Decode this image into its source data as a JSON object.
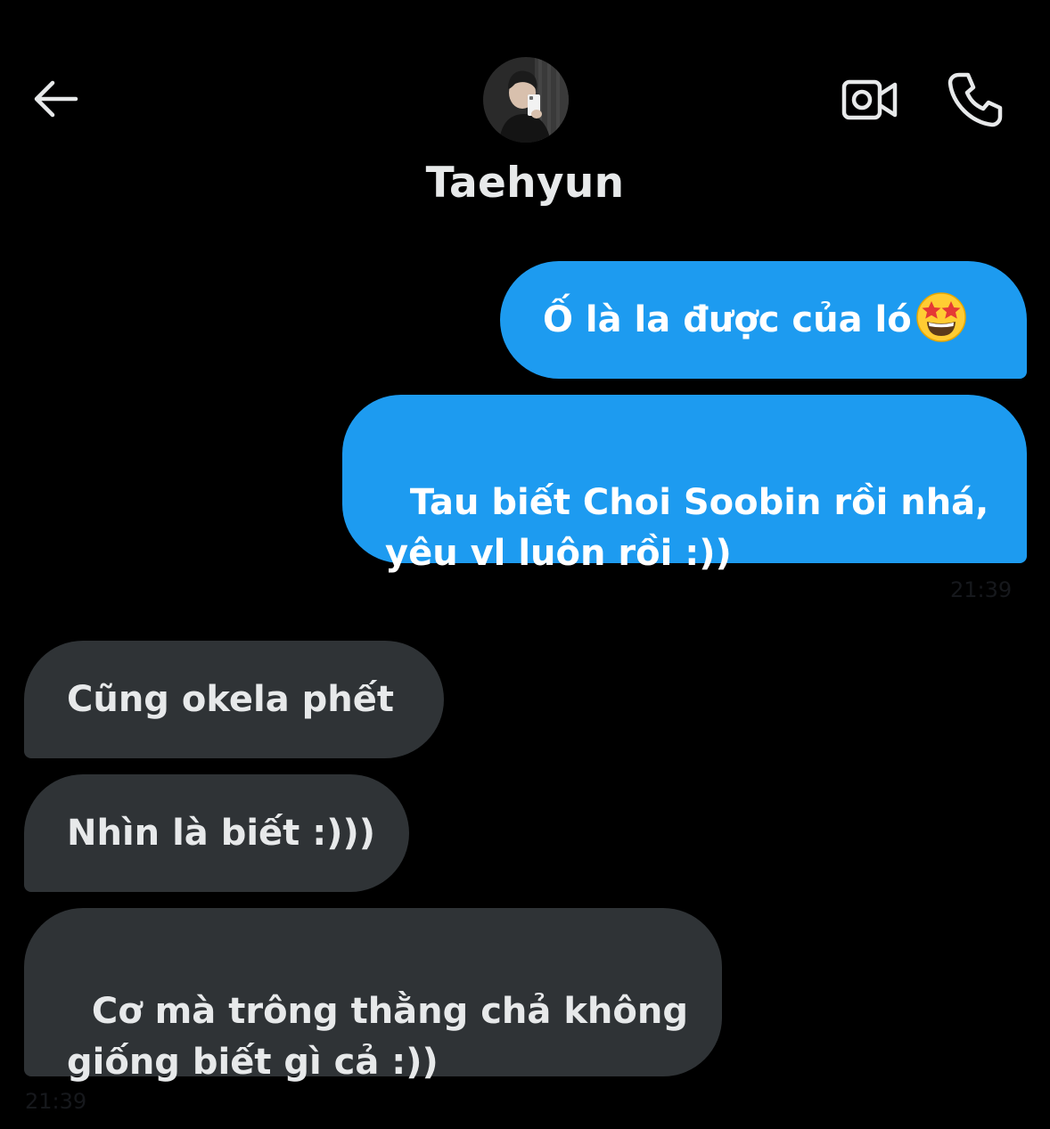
{
  "header": {
    "back_icon": "arrow-left-icon",
    "contact_name": "Taehyun",
    "video_icon": "video-camera-icon",
    "call_icon": "phone-icon"
  },
  "messages": [
    {
      "direction": "outgoing",
      "text": "Ố là la được của ló",
      "emoji": "star-struck-emoji"
    },
    {
      "direction": "outgoing",
      "text": "Tau biết Choi Soobin rồi nhá,\nyêu vl luôn rồi :))"
    },
    {
      "direction": "incoming",
      "text": "Cũng okela phết"
    },
    {
      "direction": "incoming",
      "text": "Nhìn là biết :)))"
    },
    {
      "direction": "incoming",
      "text": "Cơ mà trông thằng chả không\ngiống biết gì cả :))"
    }
  ],
  "timestamps": {
    "outgoing": "21:39",
    "incoming": "21:39"
  },
  "colors": {
    "background": "#000000",
    "outgoing_bubble": "#1d9bf0",
    "incoming_bubble": "#2f3336",
    "text_primary": "#e7e9ea"
  }
}
